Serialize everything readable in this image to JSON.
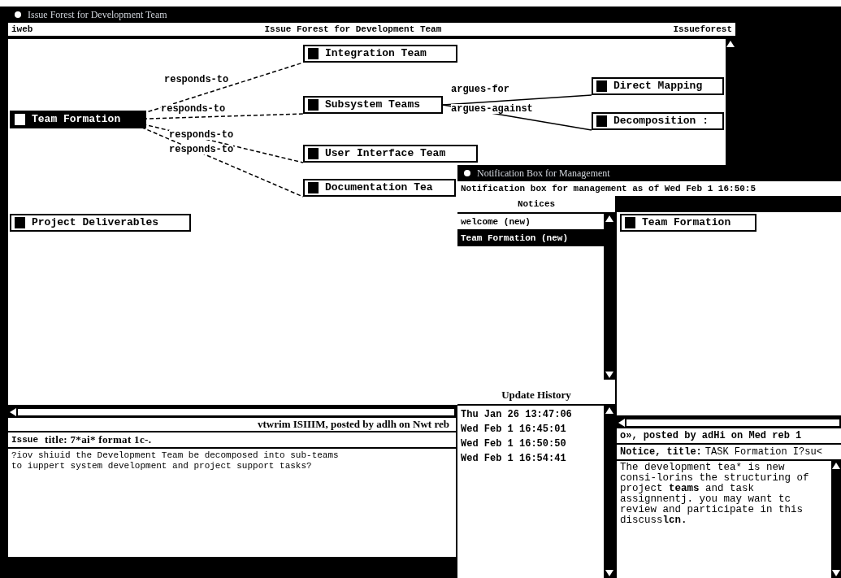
{
  "issue_forest_window": {
    "title": "Issue Forest for Development Team",
    "header": {
      "left": "iweb",
      "center": "Issue Forest for Development Team",
      "right": "Issueforest"
    },
    "nodes": [
      {
        "label": "Team Formation",
        "selected": true
      },
      {
        "label": "Integration Team",
        "selected": false
      },
      {
        "label": "Subsystem Teams",
        "selected": false
      },
      {
        "label": "User Interface Team",
        "selected": false
      },
      {
        "label": "Documentation Tea",
        "selected": false
      },
      {
        "label": "Direct Mapping",
        "selected": false
      },
      {
        "label": "Decomposition :",
        "selected": false
      },
      {
        "label": "Project Deliverables",
        "selected": false
      }
    ],
    "edges": [
      {
        "label": "responds-to"
      },
      {
        "label": "responds-to"
      },
      {
        "label": "responds-to"
      },
      {
        "label": "responds-to"
      },
      {
        "label": "argues-for"
      },
      {
        "label": "argues-against"
      }
    ],
    "posted_line": "vtwrim ISIIIM, posted by adlh on Nwt reb",
    "issue_title": {
      "label": "Issue",
      "text": "title: 7*ai* format 1c-."
    },
    "body_lines": [
      "?iov shiuid the Development Team be decomposed into sub-teams",
      "to iuppert system development and project support tasks?"
    ]
  },
  "notification_window": {
    "title": "Notification Box for Management",
    "header": "Notification box for management as of Wed Feb  1 16:50:5",
    "notices_label": "Notices",
    "notices": [
      {
        "label": "welcome (new)",
        "selected": false
      },
      {
        "label": "Team Formation (new)",
        "selected": true
      }
    ],
    "history_label": "Update History",
    "history": [
      "Thu Jan 26 13:47:06",
      "Wed Feb  1 16:45:01",
      "Wed Feb  1 16:50:50",
      "Wed Feb  1 16:54:41"
    ],
    "node": {
      "label": "Team Formation",
      "selected": false
    },
    "posted_line": "o», posted by adHi on Med reb  1",
    "notice_title": {
      "label": "Notice, title:",
      "text": "TASK Formation I?su<"
    },
    "body": [
      {
        "text": "The development tea* is new consi-lorins the structuring of project ",
        "bold": false
      },
      {
        "text": "teams",
        "bold": true
      },
      {
        "text": " and task assignnentj. you may want tc review and participate in this discuss",
        "bold": false
      },
      {
        "text": "lcn.",
        "bold": true
      }
    ]
  }
}
